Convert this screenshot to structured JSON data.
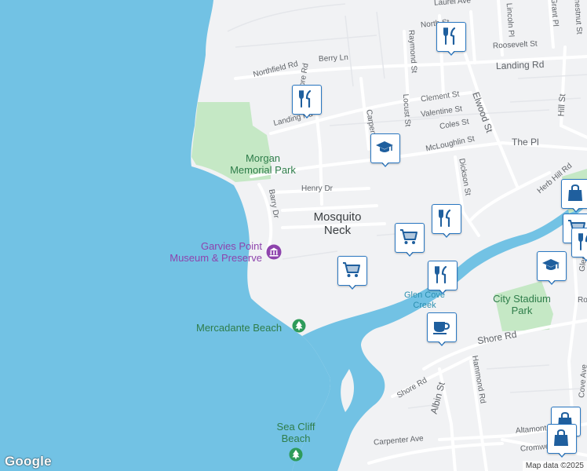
{
  "map": {
    "area_label_line1": "Mosquito",
    "area_label_line2": "Neck",
    "streets": {
      "laurel_ave": "Laurel Ave",
      "north_st": "North St",
      "lincoln_pl": "Lincoln Pl",
      "grant_pl": "Grant Pl",
      "chestnut_st": "Chestnut St",
      "roosevelt_st": "Roosevelt St",
      "northfield_rd": "Northfield Rd",
      "berry_ln": "Berry Ln",
      "landing_rd_east": "Landing Rd",
      "raymond_st": "Raymond St",
      "seashore_rd": "Seashore Rd",
      "clement_st": "Clement St",
      "locust_st": "Locust St",
      "elwood_st": "Elwood St",
      "hill_st": "Hill St",
      "valentine_st": "Valentine St",
      "landing_rd_west": "Landing Rd",
      "carpenter_st": "Carpenter St",
      "coles_st": "Coles St",
      "mcloughlin_st": "McLoughlin St",
      "the_pl": "The Pl",
      "herb_hill_rd": "Herb Hill Rd",
      "henry_dr": "Henry Dr",
      "barry_dr": "Barry Dr",
      "dickson_st": "Dickson St",
      "glen_cove_rd": "Glen",
      "shore_rd_east": "Shore Rd",
      "shore_rd_south": "Shore Rd",
      "albin_st": "Albin St",
      "hammond_rd": "Hammond Rd",
      "altamont": "Altamont",
      "carpenter_ave": "Carpenter Ave",
      "cromwell": "Cromwell",
      "cove_ave": "Cove Ave",
      "ro": "Ro"
    },
    "parks": {
      "morgan_line1": "Morgan",
      "morgan_line2": "Memorial Park",
      "city_stadium_line1": "City Stadium",
      "city_stadium_line2": "Park",
      "mercadante": "Mercadante Beach",
      "sea_cliff_line1": "Sea Cliff",
      "sea_cliff_line2": "Beach"
    },
    "poi": {
      "museum_line1": "Garvies Point",
      "museum_line2": "Museum & Preserve"
    },
    "water": {
      "creek_line1": "Glen Cove",
      "creek_line2": "Creek"
    },
    "markers": [
      {
        "type": "restaurant",
        "icon": "fork-knife-icon"
      },
      {
        "type": "restaurant",
        "icon": "fork-knife-icon"
      },
      {
        "type": "school",
        "icon": "graduation-cap-icon"
      },
      {
        "type": "restaurant",
        "icon": "fork-knife-icon"
      },
      {
        "type": "grocery",
        "icon": "shopping-cart-icon"
      },
      {
        "type": "grocery",
        "icon": "shopping-cart-icon"
      },
      {
        "type": "restaurant",
        "icon": "fork-knife-icon"
      },
      {
        "type": "cafe",
        "icon": "coffee-cup-icon"
      },
      {
        "type": "shopping",
        "icon": "shopping-bag-icon"
      },
      {
        "type": "school",
        "icon": "graduation-cap-icon"
      },
      {
        "type": "grocery",
        "icon": "shopping-cart-icon"
      },
      {
        "type": "restaurant",
        "icon": "fork-knife-icon"
      },
      {
        "type": "shopping",
        "icon": "shopping-bag-icon"
      },
      {
        "type": "shopping",
        "icon": "shopping-bag-icon"
      }
    ],
    "colors": {
      "water": "#72c2e4",
      "land": "#f1f2f4",
      "park": "#c5e8c5",
      "marker_border": "#2b78c2",
      "marker_icon": "#1f5f9e"
    }
  },
  "branding": {
    "logo": "Google",
    "attribution": "Map data ©2025"
  }
}
